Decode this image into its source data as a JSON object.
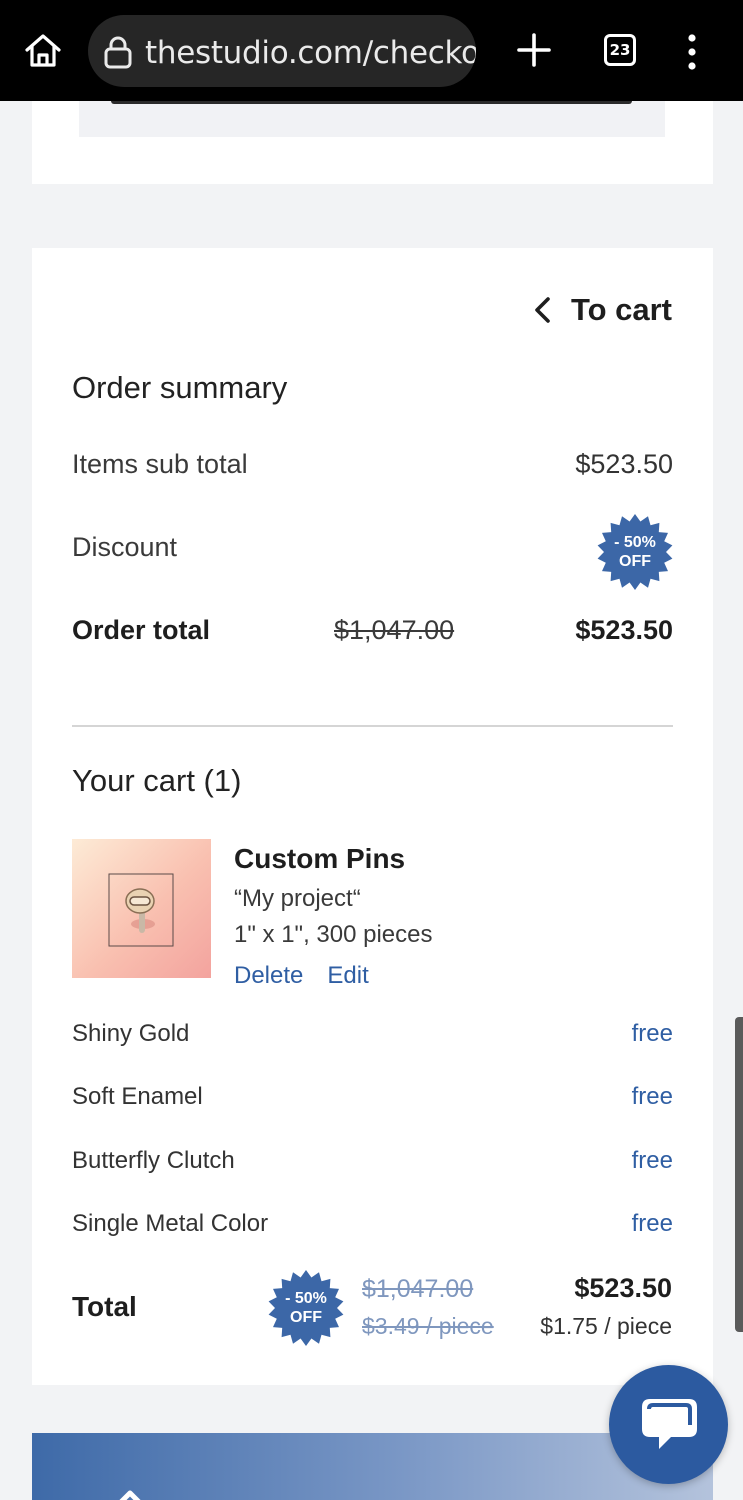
{
  "browser": {
    "url": "thestudio.com/checko",
    "tab_count": "23"
  },
  "summary": {
    "to_cart": "To cart",
    "title": "Order summary",
    "items_subtotal_label": "Items sub total",
    "items_subtotal_value": "$523.50",
    "discount_label": "Discount",
    "discount_badge_line1": "- 50%",
    "discount_badge_line2": "OFF",
    "order_total_label": "Order total",
    "order_total_original": "$1,047.00",
    "order_total_value": "$523.50"
  },
  "cart": {
    "title": "Your cart (1)",
    "product": {
      "name": "Custom Pins",
      "project": "“My project“",
      "size_qty": "1\" x 1\",  300 pieces",
      "delete": "Delete",
      "edit": "Edit"
    },
    "options": [
      {
        "label": "Shiny Gold",
        "price": "free"
      },
      {
        "label": "Soft Enamel",
        "price": "free"
      },
      {
        "label": "Butterfly Clutch",
        "price": "free"
      },
      {
        "label": "Single Metal Color",
        "price": "free"
      }
    ],
    "total": {
      "label": "Total",
      "badge_line1": "- 50%",
      "badge_line2": "OFF",
      "original_total": "$1,047.00",
      "original_piece": "$3.49 / piece",
      "new_total": "$523.50",
      "new_piece": "$1.75 / piece"
    }
  },
  "colors": {
    "accent": "#2f5ea3",
    "badge": "#3c67a7",
    "chat_button": "#2c5aa0"
  }
}
